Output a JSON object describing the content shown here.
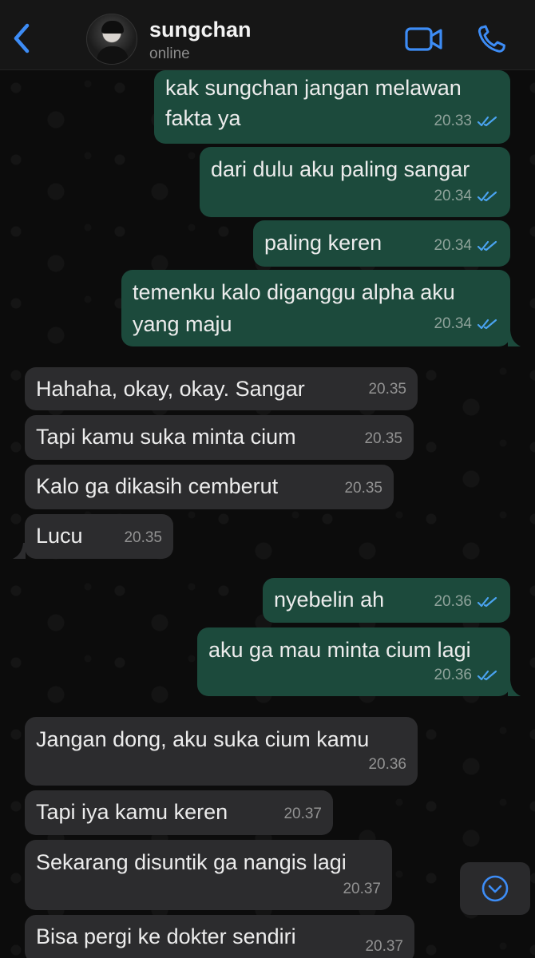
{
  "header": {
    "back_icon": "chevron-left-icon",
    "contact_name": "sungchan",
    "status": "online",
    "video_icon": "video-camera-icon",
    "call_icon": "phone-icon",
    "accent_color": "#3d8cf5"
  },
  "messages": [
    {
      "direction": "out",
      "lines": [
        "kak sungchan jangan melawan",
        "fakta ya"
      ],
      "time": "20.33",
      "read": true
    },
    {
      "direction": "out",
      "lines": [
        "dari dulu aku paling sangar"
      ],
      "time": "20.34",
      "read": true
    },
    {
      "direction": "out",
      "lines": [
        "paling keren"
      ],
      "time": "20.34",
      "read": true
    },
    {
      "direction": "out",
      "lines": [
        "temenku kalo diganggu alpha aku",
        "yang maju"
      ],
      "time": "20.34",
      "read": true
    },
    {
      "direction": "in",
      "lines": [
        "Hahaha, okay, okay. Sangar"
      ],
      "time": "20.35"
    },
    {
      "direction": "in",
      "lines": [
        "Tapi kamu suka minta cium"
      ],
      "time": "20.35"
    },
    {
      "direction": "in",
      "lines": [
        "Kalo ga dikasih cemberut"
      ],
      "time": "20.35"
    },
    {
      "direction": "in",
      "lines": [
        "Lucu"
      ],
      "time": "20.35"
    },
    {
      "direction": "out",
      "lines": [
        "nyebelin ah"
      ],
      "time": "20.36",
      "read": true
    },
    {
      "direction": "out",
      "lines": [
        "aku ga mau minta cium lagi"
      ],
      "time": "20.36",
      "read": true
    },
    {
      "direction": "in",
      "lines": [
        "Jangan dong, aku suka cium kamu"
      ],
      "time": "20.36"
    },
    {
      "direction": "in",
      "lines": [
        "Tapi iya kamu keren"
      ],
      "time": "20.37"
    },
    {
      "direction": "in",
      "lines": [
        "Sekarang disuntik ga nangis lagi"
      ],
      "time": "20.37"
    },
    {
      "direction": "in",
      "lines": [
        "Bisa pergi ke dokter sendiri"
      ],
      "time": "20.37"
    }
  ],
  "scroll_down_icon": "chevron-down-circle-icon",
  "colors": {
    "outgoing_bubble": "#1c4a3c",
    "incoming_bubble": "#2c2c2e",
    "read_ticks": "#4aa3f0"
  }
}
